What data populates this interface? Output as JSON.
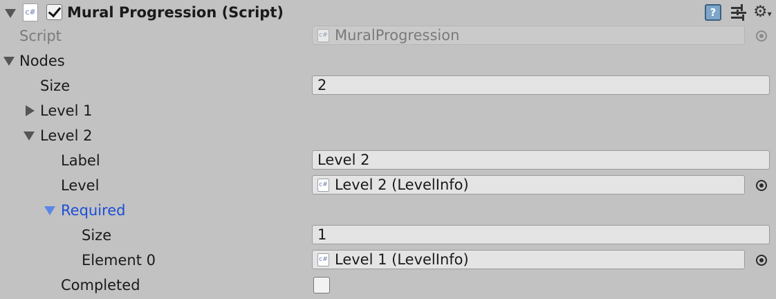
{
  "component": {
    "title": "Mural Progression (Script)",
    "enabled": true,
    "icon": "cs-script-icon",
    "header_icons": [
      "help-icon",
      "preset-icon",
      "gear-icon"
    ]
  },
  "script_row": {
    "label": "Script",
    "value": "MuralProgression",
    "icon_text": "c#"
  },
  "nodes": {
    "label": "Nodes",
    "size_label": "Size",
    "size_value": "2",
    "level1_label": "Level 1",
    "level2": {
      "label": "Level 2",
      "label_field_label": "Label",
      "label_field_value": "Level 2",
      "level_field_label": "Level",
      "level_field_value": "Level 2 (LevelInfo)",
      "required": {
        "label": "Required",
        "size_label": "Size",
        "size_value": "1",
        "element0_label": "Element 0",
        "element0_value": "Level 1 (LevelInfo)"
      },
      "completed_label": "Completed",
      "completed_checked": false
    }
  },
  "icon_text": "c#",
  "colors": {
    "background": "#c2c2c2",
    "field_bg": "#e4e4e4",
    "selected_label": "#1c4ed6",
    "selected_arrow": "#5a86e8"
  }
}
